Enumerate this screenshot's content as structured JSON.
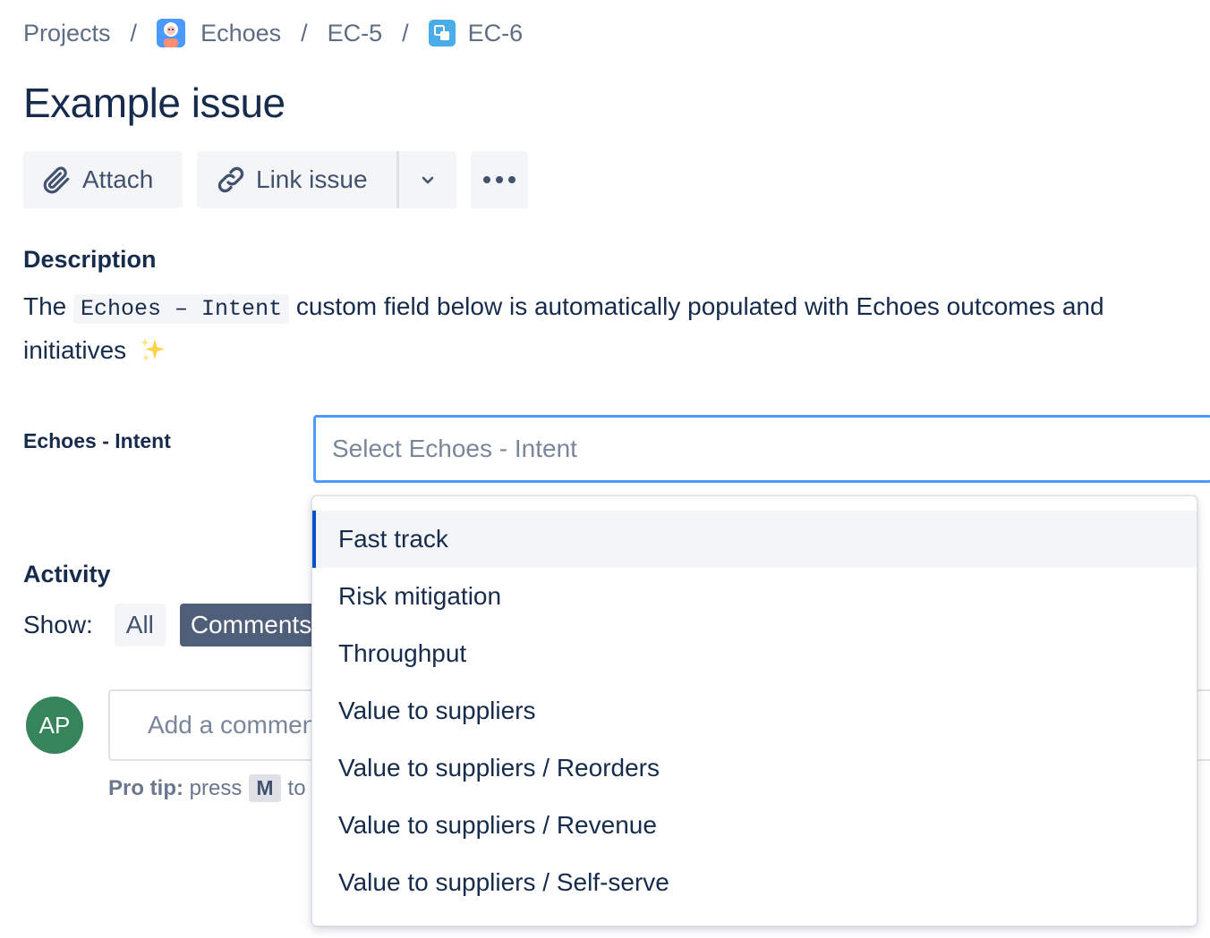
{
  "breadcrumbs": {
    "items": [
      "Projects",
      "Echoes",
      "EC-5",
      "EC-6"
    ],
    "separator": "/"
  },
  "issue": {
    "title": "Example issue"
  },
  "toolbar": {
    "attach_label": "Attach",
    "link_issue_label": "Link issue"
  },
  "description": {
    "heading": "Description",
    "text_before": "The",
    "code": "Echoes – Intent",
    "text_after": "custom field below is automatically populated with Echoes outcomes and initiatives"
  },
  "field": {
    "label": "Echoes - Intent",
    "placeholder": "Select Echoes - Intent",
    "options": [
      "Fast track",
      "Risk mitigation",
      "Throughput",
      "Value to suppliers",
      "Value to suppliers / Reorders",
      "Value to suppliers / Revenue",
      "Value to suppliers / Self-serve"
    ],
    "highlighted_option": "Fast track"
  },
  "activity": {
    "heading": "Activity",
    "show_label": "Show:",
    "filters": [
      "All",
      "Comments"
    ],
    "active_filter": "Comments"
  },
  "comment": {
    "avatar_initials": "AP",
    "placeholder": "Add a comment",
    "pro_tip_label": "Pro tip:",
    "pro_tip_text_before": "press",
    "pro_tip_key": "M",
    "pro_tip_text_after": "to"
  },
  "colors": {
    "focus_border": "#4c9aff",
    "selected_indicator": "#0052cc",
    "avatar_bg": "#36845a",
    "active_filter_bg": "#505f79"
  }
}
